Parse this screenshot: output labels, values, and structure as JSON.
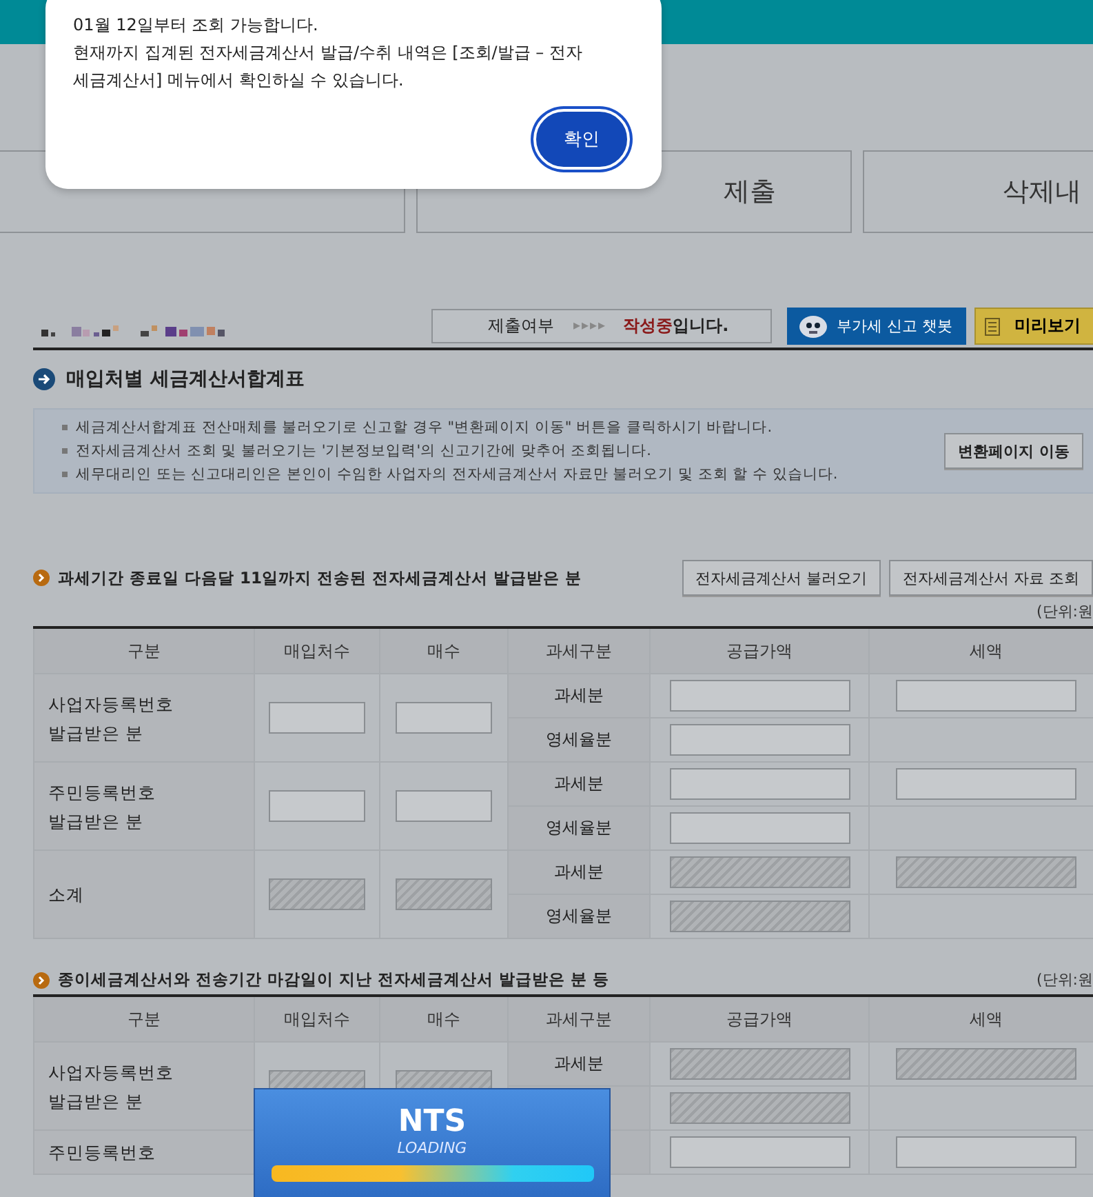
{
  "dialog": {
    "lines": [
      "01월 12일부터 조회 가능합니다.",
      "현재까지 집계된 전자세금계산서 발급/수취 내역은 [조회/발급 – 전자",
      "세금계산서] 메뉴에서 확인하실 수 있습니다."
    ],
    "button": "확인"
  },
  "tabs": [
    {
      "selected": false
    },
    {
      "label": "제출",
      "selected": false
    },
    {
      "label": "삭제내",
      "selected": false
    }
  ],
  "status": {
    "label": "제출여부",
    "arrows": "▸▸▸▸",
    "state": "작성중",
    "suffix": "입니다."
  },
  "chatbot_button": "부가세 신고 챗봇",
  "preview_button": "미리보기",
  "heading": "매입처별 세금계산서합계표",
  "notices": [
    "세금계산서합계표 전산매체를 불러오기로 신고할 경우 \"변환페이지 이동\" 버튼을 클릭하시기 바랍니다.",
    "전자세금계산서 조회 및 불러오기는 '기본정보입력'의 신고기간에 맞추어 조회됩니다.",
    "세무대리인 또는 신고대리인은 본인이 수임한 사업자의 전자세금계산서 자료만 불러오기 및 조회 할 수 있습니다."
  ],
  "convert_button": "변환페이지 이동",
  "sections": [
    {
      "title": "과세기간 종료일 다음달 11일까지 전송된 전자세금계산서 발급받은 분",
      "buttons": [
        "전자세금계산서 불러오기",
        "전자세금계산서 자료 조회"
      ],
      "unit": "(단위:원",
      "columns": [
        "구분",
        "매입처수",
        "매수",
        "과세구분",
        "공급가액",
        "세액"
      ],
      "groups": [
        {
          "label": "사업자등록번호\n발급받은 분",
          "count": {
            "disabled": false
          },
          "sheets": {
            "disabled": false
          },
          "rows": [
            {
              "type": "과세분",
              "supply": {
                "disabled": false
              },
              "tax": {
                "disabled": false
              }
            },
            {
              "type": "영세율분",
              "supply": {
                "disabled": false
              }
            }
          ]
        },
        {
          "label": "주민등록번호\n발급받은 분",
          "count": {
            "disabled": false
          },
          "sheets": {
            "disabled": false
          },
          "rows": [
            {
              "type": "과세분",
              "supply": {
                "disabled": false
              },
              "tax": {
                "disabled": false
              }
            },
            {
              "type": "영세율분",
              "supply": {
                "disabled": false
              }
            }
          ]
        },
        {
          "label": "소계",
          "count": {
            "disabled": true
          },
          "sheets": {
            "disabled": true
          },
          "rows": [
            {
              "type": "과세분",
              "supply": {
                "disabled": true
              },
              "tax": {
                "disabled": true
              }
            },
            {
              "type": "영세율분",
              "supply": {
                "disabled": true
              }
            }
          ]
        }
      ]
    },
    {
      "title": "종이세금계산서와 전송기간 마감일이 지난 전자세금계산서 발급받은 분 등",
      "unit": "(단위:원",
      "columns": [
        "구분",
        "매입처수",
        "매수",
        "과세구분",
        "공급가액",
        "세액"
      ],
      "groups": [
        {
          "label": "사업자등록번호\n발급받은 분",
          "count": {
            "disabled": true
          },
          "sheets": {
            "disabled": true
          },
          "rows": [
            {
              "type": "과세분",
              "supply": {
                "disabled": true
              },
              "tax": {
                "disabled": true
              }
            },
            {
              "supply": {
                "disabled": true
              }
            }
          ]
        },
        {
          "label": "주민등록번호",
          "rows": [
            {
              "supply": {
                "disabled": false
              },
              "tax": {
                "disabled": false
              }
            }
          ]
        }
      ]
    }
  ],
  "loading": {
    "title": "NTS",
    "subtitle": "LOADING"
  }
}
